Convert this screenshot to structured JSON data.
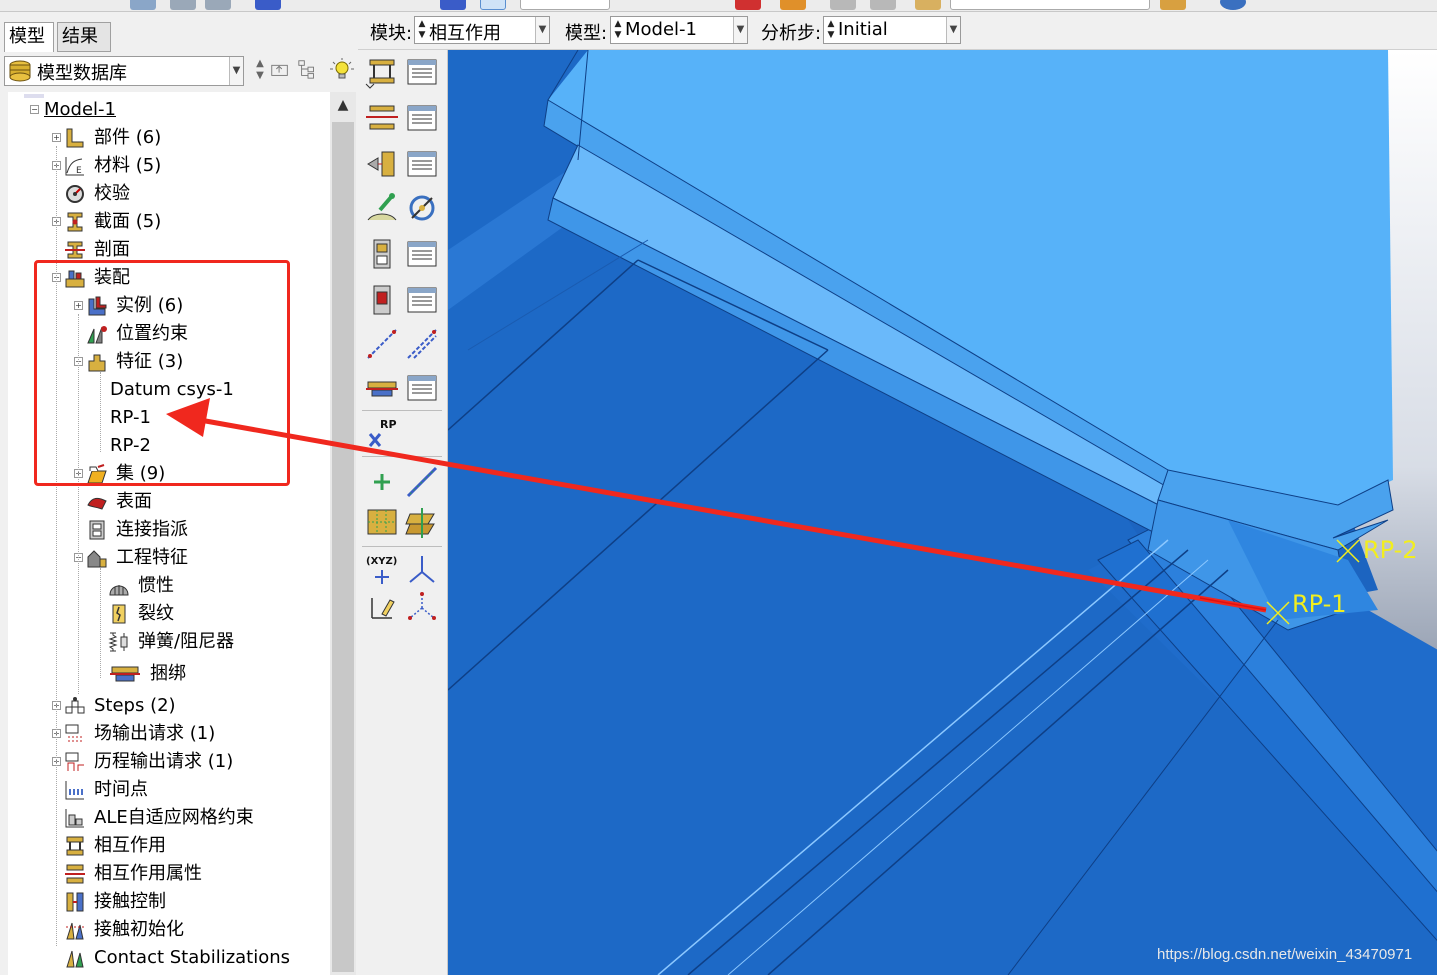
{
  "tabs": {
    "model": "模型",
    "results": "结果"
  },
  "database": {
    "selected": "模型数据库"
  },
  "context_bar": {
    "module_label": "模块:",
    "module_value": "相互作用",
    "model_label": "模型:",
    "model_value": "Model-1",
    "step_label": "分析步:",
    "step_value": "Initial"
  },
  "tree": {
    "model": "Model-1",
    "parts": "部件 (6)",
    "materials": "材料 (5)",
    "calibrations": "校验",
    "sections": "截面 (5)",
    "profiles": "剖面",
    "assembly": "装配",
    "instances": "实例 (6)",
    "position_constraints": "位置约束",
    "features": "特征 (3)",
    "datum_csys": "Datum csys-1",
    "rp1": "RP-1",
    "rp2": "RP-2",
    "sets": "集 (9)",
    "surfaces": "表面",
    "connector_assignments": "连接指派",
    "engineering_features": "工程特征",
    "inertia": "惯性",
    "cracks": "裂纹",
    "springs_dashpots": "弹簧/阻尼器",
    "wires": "捆绑",
    "steps": "Steps (2)",
    "field_output": "场输出请求 (1)",
    "history_output": "历程输出请求 (1)",
    "time_points": "时间点",
    "ale": "ALE自适应网格约束",
    "interactions": "相互作用",
    "interaction_properties": "相互作用属性",
    "contact_controls": "接触控制",
    "contact_initializations": "接触初始化",
    "contact_stabilizations": "Contact Stabilizations"
  },
  "toolbox": {
    "rp_tool_label": "RP",
    "datum_csys_label": "(XYZ)"
  },
  "viewport": {
    "rp1_label": "RP-1",
    "rp2_label": "RP-2"
  },
  "watermark": "https://blog.csdn.net/weixin_43470971",
  "colors": {
    "highlight": "#f0281e",
    "model_top": "#57b2f9",
    "model_mid": "#3f96e8",
    "model_dark": "#1e6ac8",
    "rp_yellow": "#f2ee1e",
    "viewport_bg_bottom": "#56647c"
  }
}
